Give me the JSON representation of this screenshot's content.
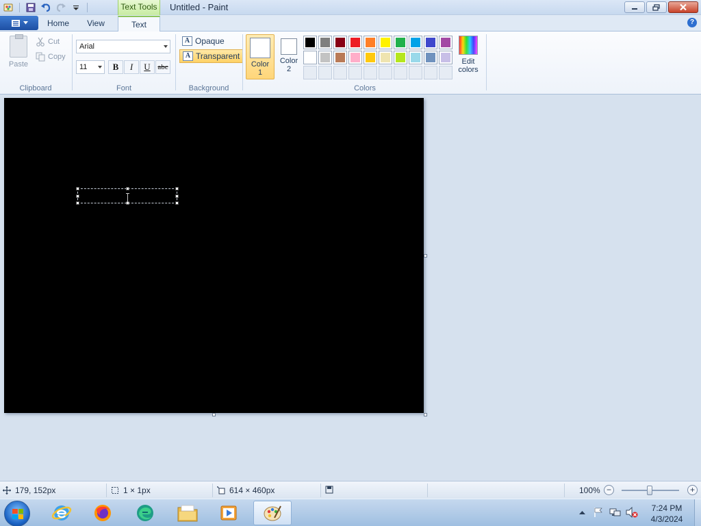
{
  "window": {
    "title": "Untitled - Paint",
    "context_tab_label": "Text Tools"
  },
  "tabs": {
    "home": "Home",
    "view": "View",
    "text": "Text"
  },
  "ribbon": {
    "clipboard": {
      "label": "Clipboard",
      "paste": "Paste",
      "cut": "Cut",
      "copy": "Copy"
    },
    "font": {
      "label": "Font",
      "family": "Arial",
      "size": "11",
      "bold": "B",
      "italic": "I",
      "underline": "U",
      "strikethrough": "abc"
    },
    "background": {
      "label": "Background",
      "opaque": "Opaque",
      "transparent": "Transparent",
      "icon_glyph": "A"
    },
    "colors": {
      "label": "Colors",
      "color1_line1": "Color",
      "color1_line2": "1",
      "color2_line1": "Color",
      "color2_line2": "2",
      "edit_line1": "Edit",
      "edit_line2": "colors",
      "color1_value": "#ffffff",
      "color2_value": "#ffffff",
      "palette_row1": [
        "#000000",
        "#7f7f7f",
        "#880015",
        "#ed1c24",
        "#ff7f27",
        "#fff200",
        "#22b14c",
        "#00a2e8",
        "#3f48cc",
        "#a349a4"
      ],
      "palette_row2": [
        "#ffffff",
        "#c3c3c3",
        "#b97a57",
        "#ffaec9",
        "#ffc90e",
        "#efe4b0",
        "#b5e61d",
        "#99d9ea",
        "#7092be",
        "#c8bfe7"
      ]
    }
  },
  "status": {
    "cursor_pos": "179, 152px",
    "selection_size": "1 × 1px",
    "image_size": "614 × 460px",
    "zoom": "100%"
  },
  "taskbar": {
    "time": "7:24 PM",
    "date": "4/3/2024"
  }
}
